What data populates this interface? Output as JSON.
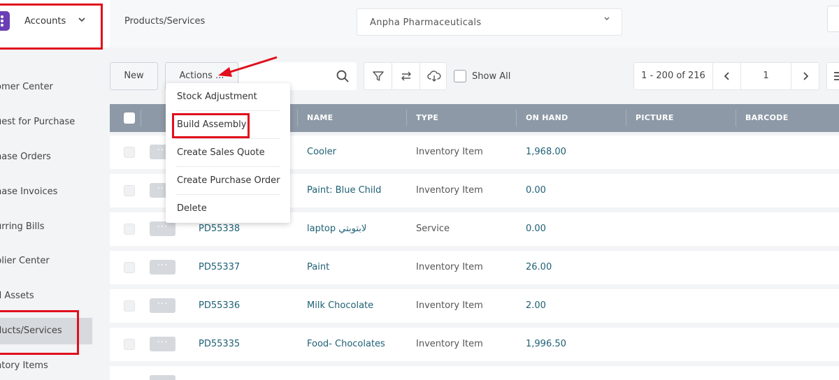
{
  "header": {
    "app_name": "Accounts",
    "page_title": "Products/Services",
    "company": "Anpha Pharmaceuticals"
  },
  "sidebar": {
    "items": [
      {
        "label": "omer Center"
      },
      {
        "label": "uest for Purchase"
      },
      {
        "label": "hase Orders"
      },
      {
        "label": "hase Invoices"
      },
      {
        "label": "urring Bills"
      },
      {
        "label": "plier Center"
      },
      {
        "label": "d Assets"
      },
      {
        "label": "ducts/Services"
      },
      {
        "label": "ntory Items"
      }
    ]
  },
  "toolbar": {
    "new_label": "New",
    "actions_label": "Actions ...",
    "show_all_label": "Show All",
    "pager_range": "1 - 200 of 216",
    "page_number": "1"
  },
  "actions_menu": {
    "items": [
      {
        "label": "Stock Adjustment"
      },
      {
        "label": "Build Assembly"
      },
      {
        "label": "Create Sales Quote"
      },
      {
        "label": "Create Purchase Order"
      },
      {
        "label": "Delete"
      }
    ]
  },
  "table": {
    "columns": [
      "NAME",
      "TYPE",
      "ON HAND",
      "PICTURE",
      "BARCODE"
    ],
    "rows": [
      {
        "code": "",
        "name": "Cooler",
        "type": "Inventory Item",
        "on_hand": "1,968.00"
      },
      {
        "code": "",
        "name": "Paint: Blue Child",
        "type": "Inventory Item",
        "on_hand": "0.00"
      },
      {
        "code": "PD55338",
        "name": "laptop لابتوبتي",
        "type": "Service",
        "on_hand": "0.00"
      },
      {
        "code": "PD55337",
        "name": "Paint",
        "type": "Inventory Item",
        "on_hand": "26.00"
      },
      {
        "code": "PD55336",
        "name": "Milk Chocolate",
        "type": "Inventory Item",
        "on_hand": "2.00"
      },
      {
        "code": "PD55335",
        "name": "Food- Chocolates",
        "type": "Inventory Item",
        "on_hand": "1,996.50"
      }
    ]
  },
  "colors": {
    "accent": "#6a3fb5",
    "table_header": "#8d99a6",
    "link": "#1f6075",
    "annotation": "#e0101c"
  }
}
